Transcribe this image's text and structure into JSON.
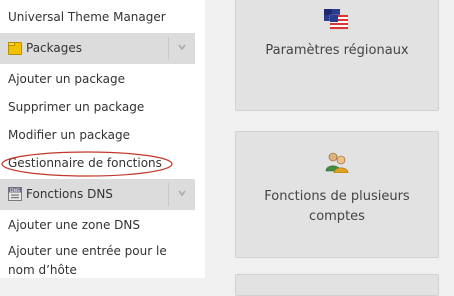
{
  "sidebar": {
    "top_link": "Universal Theme Manager",
    "sections": [
      {
        "label": "Packages",
        "icon": "folder-icon",
        "items": [
          "Ajouter un package",
          "Supprimer un package",
          "Modifier un package",
          "Gestionnaire de fonctions"
        ]
      },
      {
        "label": "Fonctions DNS",
        "icon": "dns-icon",
        "icon_text": "DNS",
        "items": [
          "Ajouter une zone DNS",
          "Ajouter une entrée pour le nom d’hôte"
        ]
      }
    ]
  },
  "cards": [
    {
      "label": "Paramètres régionaux",
      "icon": "flags-icon"
    },
    {
      "label": "Fonctions de plusieurs comptes",
      "icon": "users-icon"
    }
  ],
  "highlight": {
    "target": "Gestionnaire de fonctions",
    "color": "#c0392b"
  }
}
